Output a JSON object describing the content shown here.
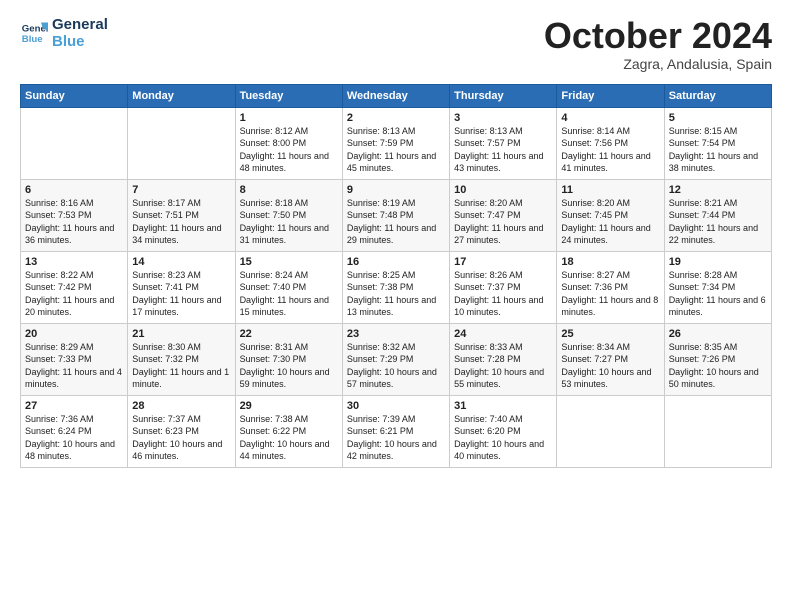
{
  "logo": {
    "line1": "General",
    "line2": "Blue"
  },
  "title": "October 2024",
  "subtitle": "Zagra, Andalusia, Spain",
  "weekdays": [
    "Sunday",
    "Monday",
    "Tuesday",
    "Wednesday",
    "Thursday",
    "Friday",
    "Saturday"
  ],
  "weeks": [
    [
      {
        "day": "",
        "info": ""
      },
      {
        "day": "",
        "info": ""
      },
      {
        "day": "1",
        "info": "Sunrise: 8:12 AM\nSunset: 8:00 PM\nDaylight: 11 hours and 48 minutes."
      },
      {
        "day": "2",
        "info": "Sunrise: 8:13 AM\nSunset: 7:59 PM\nDaylight: 11 hours and 45 minutes."
      },
      {
        "day": "3",
        "info": "Sunrise: 8:13 AM\nSunset: 7:57 PM\nDaylight: 11 hours and 43 minutes."
      },
      {
        "day": "4",
        "info": "Sunrise: 8:14 AM\nSunset: 7:56 PM\nDaylight: 11 hours and 41 minutes."
      },
      {
        "day": "5",
        "info": "Sunrise: 8:15 AM\nSunset: 7:54 PM\nDaylight: 11 hours and 38 minutes."
      }
    ],
    [
      {
        "day": "6",
        "info": "Sunrise: 8:16 AM\nSunset: 7:53 PM\nDaylight: 11 hours and 36 minutes."
      },
      {
        "day": "7",
        "info": "Sunrise: 8:17 AM\nSunset: 7:51 PM\nDaylight: 11 hours and 34 minutes."
      },
      {
        "day": "8",
        "info": "Sunrise: 8:18 AM\nSunset: 7:50 PM\nDaylight: 11 hours and 31 minutes."
      },
      {
        "day": "9",
        "info": "Sunrise: 8:19 AM\nSunset: 7:48 PM\nDaylight: 11 hours and 29 minutes."
      },
      {
        "day": "10",
        "info": "Sunrise: 8:20 AM\nSunset: 7:47 PM\nDaylight: 11 hours and 27 minutes."
      },
      {
        "day": "11",
        "info": "Sunrise: 8:20 AM\nSunset: 7:45 PM\nDaylight: 11 hours and 24 minutes."
      },
      {
        "day": "12",
        "info": "Sunrise: 8:21 AM\nSunset: 7:44 PM\nDaylight: 11 hours and 22 minutes."
      }
    ],
    [
      {
        "day": "13",
        "info": "Sunrise: 8:22 AM\nSunset: 7:42 PM\nDaylight: 11 hours and 20 minutes."
      },
      {
        "day": "14",
        "info": "Sunrise: 8:23 AM\nSunset: 7:41 PM\nDaylight: 11 hours and 17 minutes."
      },
      {
        "day": "15",
        "info": "Sunrise: 8:24 AM\nSunset: 7:40 PM\nDaylight: 11 hours and 15 minutes."
      },
      {
        "day": "16",
        "info": "Sunrise: 8:25 AM\nSunset: 7:38 PM\nDaylight: 11 hours and 13 minutes."
      },
      {
        "day": "17",
        "info": "Sunrise: 8:26 AM\nSunset: 7:37 PM\nDaylight: 11 hours and 10 minutes."
      },
      {
        "day": "18",
        "info": "Sunrise: 8:27 AM\nSunset: 7:36 PM\nDaylight: 11 hours and 8 minutes."
      },
      {
        "day": "19",
        "info": "Sunrise: 8:28 AM\nSunset: 7:34 PM\nDaylight: 11 hours and 6 minutes."
      }
    ],
    [
      {
        "day": "20",
        "info": "Sunrise: 8:29 AM\nSunset: 7:33 PM\nDaylight: 11 hours and 4 minutes."
      },
      {
        "day": "21",
        "info": "Sunrise: 8:30 AM\nSunset: 7:32 PM\nDaylight: 11 hours and 1 minute."
      },
      {
        "day": "22",
        "info": "Sunrise: 8:31 AM\nSunset: 7:30 PM\nDaylight: 10 hours and 59 minutes."
      },
      {
        "day": "23",
        "info": "Sunrise: 8:32 AM\nSunset: 7:29 PM\nDaylight: 10 hours and 57 minutes."
      },
      {
        "day": "24",
        "info": "Sunrise: 8:33 AM\nSunset: 7:28 PM\nDaylight: 10 hours and 55 minutes."
      },
      {
        "day": "25",
        "info": "Sunrise: 8:34 AM\nSunset: 7:27 PM\nDaylight: 10 hours and 53 minutes."
      },
      {
        "day": "26",
        "info": "Sunrise: 8:35 AM\nSunset: 7:26 PM\nDaylight: 10 hours and 50 minutes."
      }
    ],
    [
      {
        "day": "27",
        "info": "Sunrise: 7:36 AM\nSunset: 6:24 PM\nDaylight: 10 hours and 48 minutes."
      },
      {
        "day": "28",
        "info": "Sunrise: 7:37 AM\nSunset: 6:23 PM\nDaylight: 10 hours and 46 minutes."
      },
      {
        "day": "29",
        "info": "Sunrise: 7:38 AM\nSunset: 6:22 PM\nDaylight: 10 hours and 44 minutes."
      },
      {
        "day": "30",
        "info": "Sunrise: 7:39 AM\nSunset: 6:21 PM\nDaylight: 10 hours and 42 minutes."
      },
      {
        "day": "31",
        "info": "Sunrise: 7:40 AM\nSunset: 6:20 PM\nDaylight: 10 hours and 40 minutes."
      },
      {
        "day": "",
        "info": ""
      },
      {
        "day": "",
        "info": ""
      }
    ]
  ]
}
